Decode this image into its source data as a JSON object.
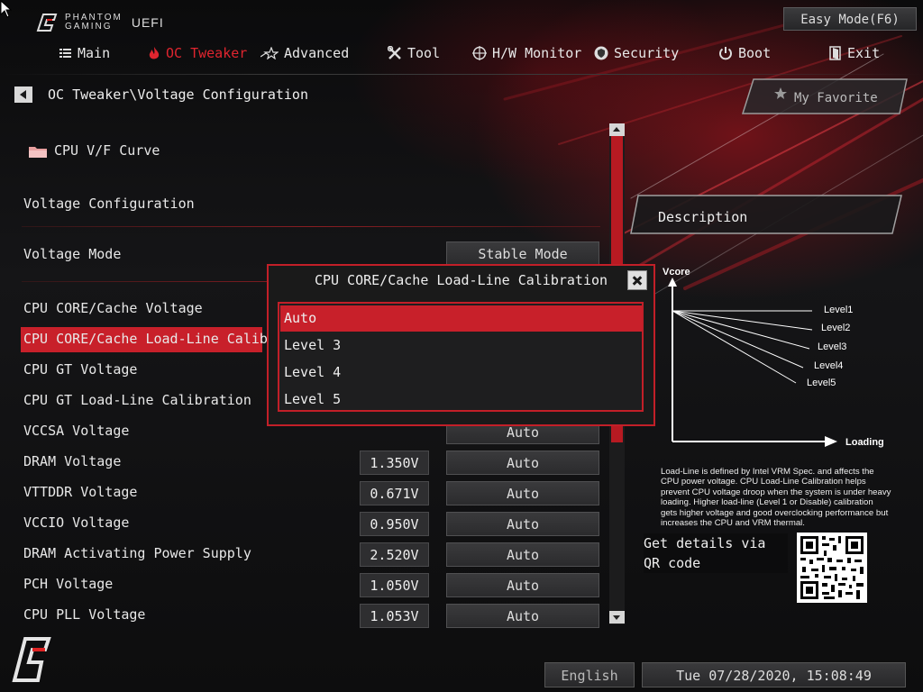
{
  "brand": {
    "line1": "PHANTOM",
    "line2": "GAMING",
    "uefi": "UEFI"
  },
  "easy_mode_label": "Easy Mode(F6)",
  "nav": [
    {
      "label": "Main",
      "icon": "list-icon",
      "active": false
    },
    {
      "label": "OC Tweaker",
      "icon": "flame-icon",
      "active": true
    },
    {
      "label": "Advanced",
      "icon": "star-icon",
      "active": false
    },
    {
      "label": "Tool",
      "icon": "tools-icon",
      "active": false
    },
    {
      "label": "H/W Monitor",
      "icon": "crosshair-icon",
      "active": false
    },
    {
      "label": "Security",
      "icon": "shield-icon",
      "active": false
    },
    {
      "label": "Boot",
      "icon": "power-icon",
      "active": false
    },
    {
      "label": "Exit",
      "icon": "door-icon",
      "active": false
    }
  ],
  "breadcrumb": "OC Tweaker\\Voltage Configuration",
  "my_favorite": "My Favorite",
  "submenu": "CPU V/F Curve",
  "section_title": "Voltage Configuration",
  "voltage_mode": {
    "label": "Voltage Mode",
    "option": "Stable Mode"
  },
  "rows": [
    {
      "label": "CPU CORE/Cache Voltage",
      "value": "",
      "option": ""
    },
    {
      "label": "CPU CORE/Cache Load-Line Calibrat",
      "value": "",
      "option": ""
    },
    {
      "label": "CPU GT Voltage",
      "value": "",
      "option": ""
    },
    {
      "label": "CPU GT Load-Line Calibration",
      "value": "",
      "option": ""
    },
    {
      "label": "VCCSA Voltage",
      "value": "",
      "option": "Auto"
    },
    {
      "label": "DRAM Voltage",
      "value": "1.350V",
      "option": "Auto"
    },
    {
      "label": "VTTDDR Voltage",
      "value": "0.671V",
      "option": "Auto"
    },
    {
      "label": "VCCIO Voltage",
      "value": "0.950V",
      "option": "Auto"
    },
    {
      "label": "DRAM Activating Power Supply",
      "value": "2.520V",
      "option": "Auto"
    },
    {
      "label": "PCH Voltage",
      "value": "1.050V",
      "option": "Auto"
    },
    {
      "label": "CPU PLL Voltage",
      "value": "1.053V",
      "option": "Auto"
    }
  ],
  "dialog": {
    "title": "CPU CORE/Cache Load-Line Calibration",
    "options": [
      "Auto",
      "Level 3",
      "Level 4",
      "Level 5"
    ],
    "selected_index": 0
  },
  "description": {
    "title": "Description",
    "graph": {
      "y_label": "Vcore",
      "x_label": "Loading",
      "levels": [
        "Level1",
        "Level2",
        "Level3",
        "Level4",
        "Level5"
      ]
    },
    "text": "Load-Line is defined by Intel VRM Spec. and affects the CPU power voltage. CPU Load-Line Calibration helps prevent CPU voltage droop when the system is under heavy loading. Higher load-line (Level 1 or Disable) calibration gets higher voltage and good overclocking performance but increases the CPU and VRM thermal.",
    "qr_text": "Get details via QR code"
  },
  "footer": {
    "language": "English",
    "datetime": "Tue 07/28/2020, 15:08:49"
  },
  "colors": {
    "accent": "#c8202a",
    "background": "#121213"
  }
}
